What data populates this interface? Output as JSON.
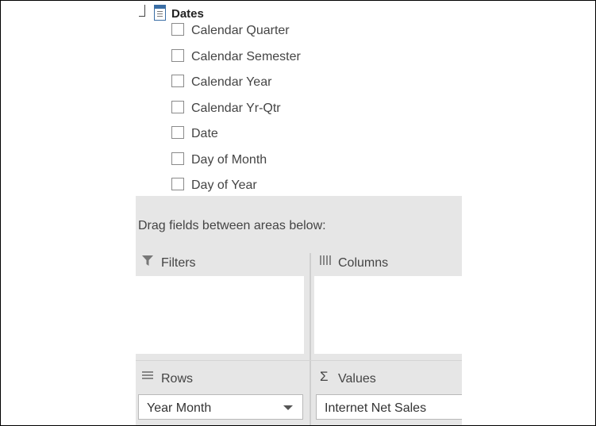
{
  "field_list": {
    "table": {
      "name": "Dates",
      "icon": "table-icon"
    },
    "fields": [
      {
        "label": "Calendar Quarter",
        "checked": false
      },
      {
        "label": "Calendar Semester",
        "checked": false
      },
      {
        "label": "Calendar Year",
        "checked": false
      },
      {
        "label": "Calendar Yr-Qtr",
        "checked": false
      },
      {
        "label": "Date",
        "checked": false
      },
      {
        "label": "Day of Month",
        "checked": false
      },
      {
        "label": "Day of Year",
        "checked": false
      }
    ]
  },
  "areas": {
    "hint": "Drag fields between areas below:",
    "filters": {
      "label": "Filters",
      "icon": "filter-icon"
    },
    "columns": {
      "label": "Columns",
      "icon": "columns-icon"
    },
    "rows": {
      "label": "Rows",
      "icon": "rows-icon",
      "field": "Year Month"
    },
    "values": {
      "label": "Values",
      "icon": "sigma-icon",
      "field": "Internet Net Sales"
    }
  }
}
